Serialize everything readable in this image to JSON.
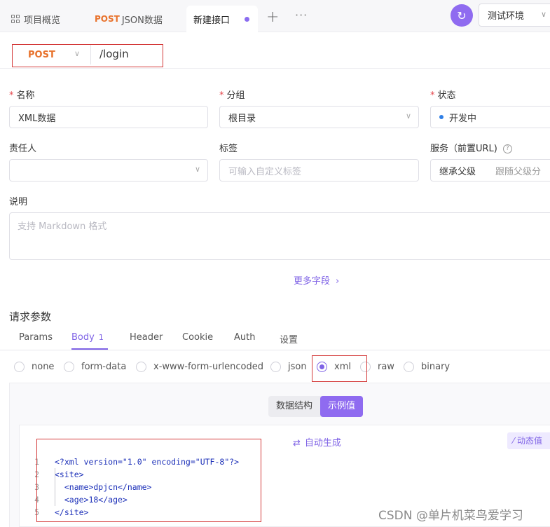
{
  "tabs": {
    "overview_label": "项目概览",
    "json_method": "POST",
    "json_label": "JSON数据",
    "active_label": "新建接口",
    "plus": "+",
    "more": "···",
    "sync_icon": "↻",
    "environment": "测试环境"
  },
  "request": {
    "method": "POST",
    "url": "/login"
  },
  "form": {
    "name_label": "名称",
    "name_value": "XML数据",
    "group_label": "分组",
    "group_value": "根目录",
    "status_label": "状态",
    "status_value": "开发中",
    "owner_label": "责任人",
    "tags_label": "标签",
    "tags_placeholder": "可输入自定义标签",
    "service_label": "服务（前置URL)",
    "service_value": "继承父级",
    "service_hint": "跟随父级分",
    "desc_label": "说明",
    "desc_placeholder": "支持 Markdown 格式",
    "more_fields": "更多字段"
  },
  "params": {
    "title": "请求参数",
    "tabs": [
      "Params",
      "Body",
      "Header",
      "Cookie",
      "Auth",
      "设置"
    ],
    "body_count": "1",
    "body_types": [
      "none",
      "form-data",
      "x-www-form-urlencoded",
      "json",
      "xml",
      "raw",
      "binary"
    ],
    "selected_body_type": "xml",
    "view_modes": [
      "数据结构",
      "示例值"
    ],
    "active_view_mode": "示例值",
    "auto_generate": "自动生成",
    "dynamic_value": "动态值"
  },
  "code": {
    "line_numbers": [
      "1",
      "2",
      "3",
      "4",
      "5"
    ],
    "lines": [
      "<?xml version=\"1.0\" encoding=\"UTF-8\"?>",
      "<site>",
      "  <name>dpjcn</name>",
      "  <age>18</age>",
      "</site>"
    ]
  },
  "watermark": "CSDN @单片机菜鸟爱学习",
  "colors": {
    "accent": "#8f6bf0",
    "method": "#e8722c",
    "annotation_box": "#d43a3a"
  }
}
